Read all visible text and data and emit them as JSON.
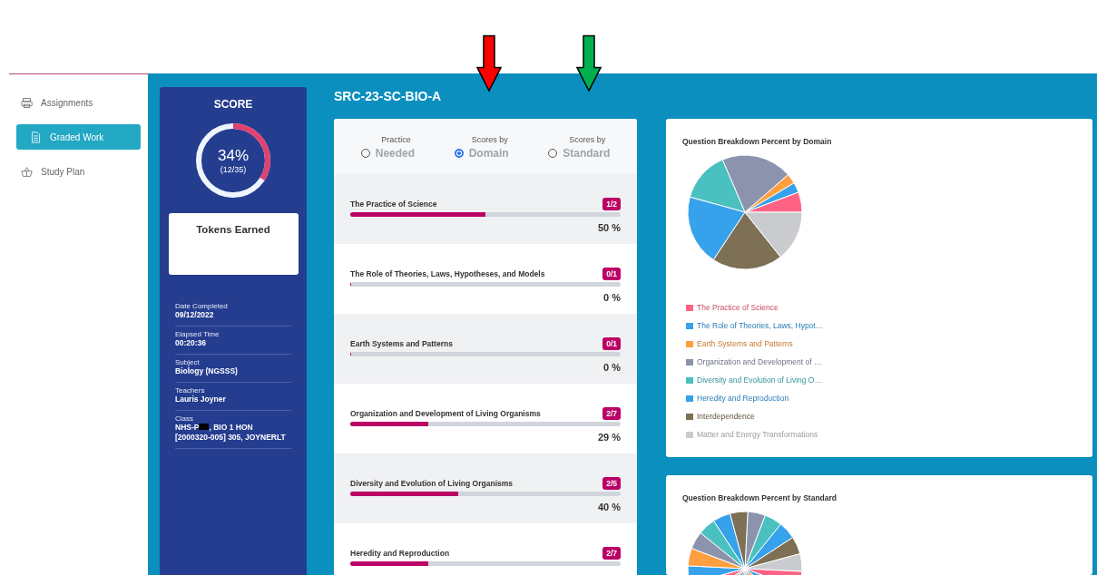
{
  "sidebar": {
    "items": [
      {
        "label": "Assignments",
        "selected": false
      },
      {
        "label": "Graded Work",
        "selected": true
      },
      {
        "label": "Study Plan",
        "selected": false
      }
    ]
  },
  "score": {
    "title": "SCORE",
    "percent": "34%",
    "fraction": "(12/35)",
    "level": 0.34,
    "tokens_title": "Tokens Earned",
    "details": [
      {
        "label": "Date Completed",
        "value": "09/12/2022"
      },
      {
        "label": "Elapsed Time",
        "value": "00:20:36"
      },
      {
        "label": "Subject",
        "value": "Biology (NGSSS)"
      },
      {
        "label": "Teachers",
        "value": "Lauris Joyner"
      }
    ],
    "class": {
      "label": "Class",
      "value_start": "NHS-P",
      "value_end": ", BIO 1 HON",
      "value_line2": "[2000320-005] 305, JOYNERLT"
    }
  },
  "assessment_title": "SRC-23-SC-BIO-A",
  "annotation_arrows": [
    {
      "color": "#ff0000"
    },
    {
      "color": "#00b050"
    }
  ],
  "view_options": [
    {
      "caption": "Practice",
      "label": "Needed",
      "selected": false
    },
    {
      "caption": "Scores by",
      "label": "Domain",
      "selected": true
    },
    {
      "caption": "Scores by",
      "label": "Standard",
      "selected": false
    }
  ],
  "domains": [
    {
      "name": "The Practice of Science",
      "score": "1/2",
      "level": 0.5,
      "percent": "50 %"
    },
    {
      "name": "The Role of Theories, Laws, Hypotheses, and Models",
      "score": "0/1",
      "level": 0,
      "percent": "0 %"
    },
    {
      "name": "Earth Systems and Patterns",
      "score": "0/1",
      "level": 0,
      "percent": "0 %"
    },
    {
      "name": "Organization and Development of Living Organisms",
      "score": "2/7",
      "level": 0.29,
      "percent": "29 %"
    },
    {
      "name": "Diversity and Evolution of Living Organisms",
      "score": "2/5",
      "level": 0.4,
      "percent": "40 %"
    },
    {
      "name": "Heredity and Reproduction",
      "score": "2/7",
      "level": 0.29
    }
  ],
  "domain_breakdown": {
    "title": "Question Breakdown Percent by Domain",
    "legend": [
      {
        "label": "The Practice of Science",
        "color": "#ff6384"
      },
      {
        "label": "The Role of Theories, Laws, Hypot…",
        "color": "#36a2eb"
      },
      {
        "label": "Earth Systems and Patterns",
        "color": "#ff9f40"
      },
      {
        "label": "Organization and Development of …",
        "color": "#8c93ad"
      },
      {
        "label": "Diversity and Evolution of Living O…",
        "color": "#4bc0c0"
      },
      {
        "label": "Heredity and Reproduction",
        "color": "#36a2eb"
      },
      {
        "label": "Interdependence",
        "color": "#7d7055"
      },
      {
        "label": "Matter and Energy Transformations",
        "color": "#c9cbcf"
      }
    ]
  },
  "standard_breakdown": {
    "title": "Question Breakdown Percent by Standard"
  }
}
